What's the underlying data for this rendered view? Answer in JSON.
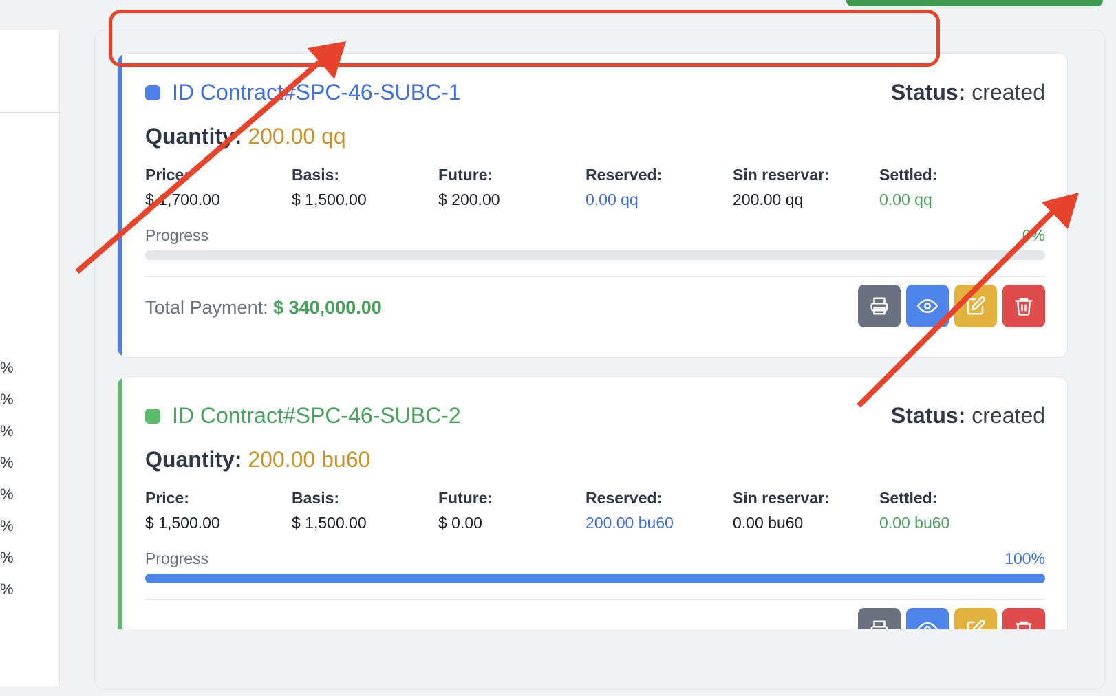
{
  "left_panel": {
    "percent_items": [
      "%",
      "%",
      "%",
      "%",
      "%",
      "%",
      "%",
      "%"
    ]
  },
  "contracts": [
    {
      "id_label": "ID Contract#SPC-46-SUBC-1",
      "accent_color": "#4f7fe8",
      "status_label": "Status:",
      "status_value": "created",
      "quantity_label": "Quantity:",
      "quantity_value": "200.00 qq",
      "fields": [
        {
          "label": "Price:",
          "value": "$ 1,700.00"
        },
        {
          "label": "Basis:",
          "value": "$ 1,500.00"
        },
        {
          "label": "Future:",
          "value": "$ 200.00"
        },
        {
          "label": "Reserved:",
          "value": "0.00 qq"
        },
        {
          "label": "Sin reservar:",
          "value": "200.00 qq"
        },
        {
          "label": "Settled:",
          "value": "0.00 qq"
        }
      ],
      "progress_label": "Progress",
      "progress_percent_text": "0%",
      "progress_value": 0,
      "total_label": "Total Payment:",
      "total_value": "$ 340,000.00"
    },
    {
      "id_label": "ID Contract#SPC-46-SUBC-2",
      "accent_color": "#5cbb6a",
      "status_label": "Status:",
      "status_value": "created",
      "quantity_label": "Quantity:",
      "quantity_value": "200.00 bu60",
      "fields": [
        {
          "label": "Price:",
          "value": "$ 1,500.00"
        },
        {
          "label": "Basis:",
          "value": "$ 1,500.00"
        },
        {
          "label": "Future:",
          "value": "$ 0.00"
        },
        {
          "label": "Reserved:",
          "value": "200.00 bu60"
        },
        {
          "label": "Sin reservar:",
          "value": "0.00 bu60"
        },
        {
          "label": "Settled:",
          "value": "0.00 bu60"
        }
      ],
      "progress_label": "Progress",
      "progress_percent_text": "100%",
      "progress_value": 100
    }
  ],
  "actions": {
    "print_icon": "printer-icon",
    "view_icon": "eye-icon",
    "edit_icon": "edit-icon",
    "delete_icon": "trash-icon"
  },
  "colors": {
    "quantity": "#c8922b",
    "reserved": "#3e6fe0",
    "settled": "#48a05a",
    "annotation": "#e8432b"
  }
}
